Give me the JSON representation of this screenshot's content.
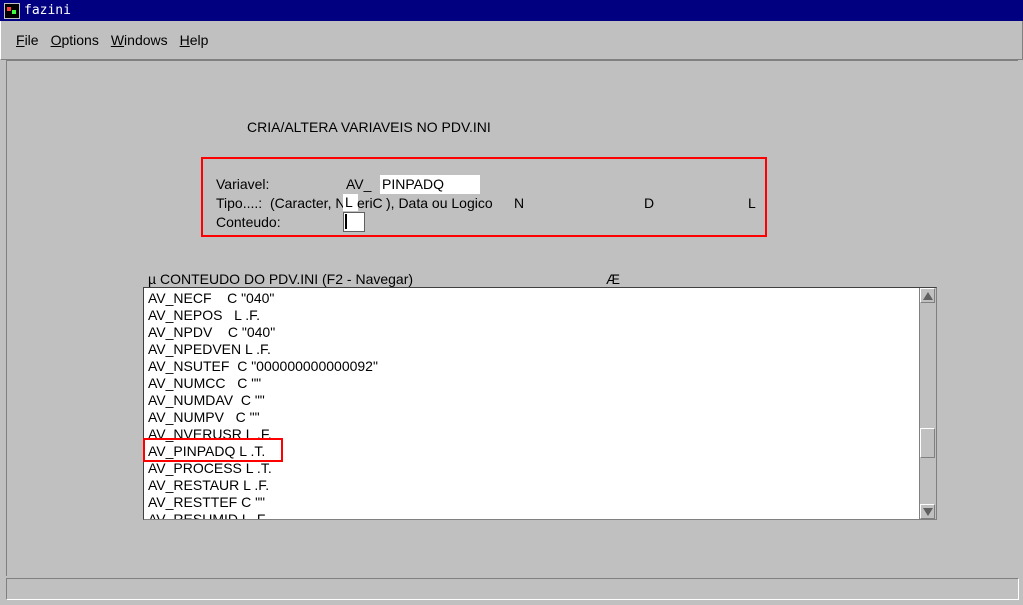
{
  "window": {
    "title": "fazini",
    "icon": "terminal-icon"
  },
  "menu": [
    {
      "mn": "F",
      "rest": "ile"
    },
    {
      "mn": "O",
      "rest": "ptions"
    },
    {
      "mn": "W",
      "rest": "indows"
    },
    {
      "mn": "H",
      "rest": "elp"
    }
  ],
  "form": {
    "title": "CRIA/ALTERA VARIAVEIS NO PDV.INI",
    "variavel_label": "Variavel:",
    "prefix": "AV_",
    "variavel_value": "PINPADQ",
    "tipo_label": "Tipo....:",
    "tipo_desc_a": "(Caracter, N",
    "tipo_value": "L",
    "tipo_desc_b": "eriC",
    "tipo_desc_c": "), Data ou Logico",
    "opt_n": "N",
    "opt_d": "D",
    "opt_l": "L",
    "conteudo_label": "Conteudo:",
    "conteudo_value": ""
  },
  "list": {
    "header": "µ CONTEUDO DO PDV.INI (F2 - Navegar)",
    "header_right": "Æ",
    "rows": [
      "AV_NECF    C \"040\"",
      "AV_NEPOS   L .F.",
      "AV_NPDV    C \"040\"",
      "AV_NPEDVEN L .F.",
      "AV_NSUTEF  C \"000000000000092\"",
      "AV_NUMCC   C \"\"",
      "AV_NUMDAV  C \"\"",
      "AV_NUMPV   C \"\"",
      "AV_NVERUSR L .F.",
      "AV_PINPADQ L .T.",
      "AV_PROCESS L .T.",
      "AV_RESTAUR L .F.",
      "AV_RESTTEF C \"\"",
      "AV_RESUMID L .F."
    ],
    "highlighted_index": 9
  },
  "colors": {
    "highlight": "#ff0000",
    "titlebar": "#000080",
    "background": "#c0c0c0"
  }
}
